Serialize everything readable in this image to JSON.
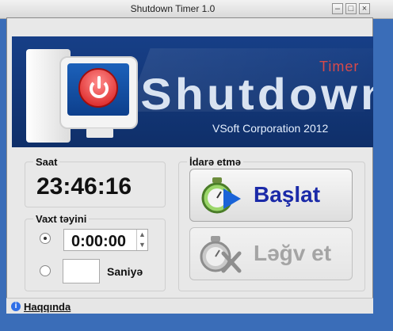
{
  "window": {
    "title": "Shutdown Timer 1.0"
  },
  "banner": {
    "title": "Shutdown",
    "subtitle": "Timer",
    "corporation": "VSoft Corporation 2012"
  },
  "clock": {
    "label": "Saat",
    "value": "23:46:16"
  },
  "timer": {
    "label": "Vaxt təyini",
    "time_value": "0:00:00",
    "seconds_label": "Saniyə",
    "selected_mode": "time"
  },
  "controls": {
    "label": "İdarə etmə",
    "start": "Başlat",
    "cancel": "Ləğv et"
  },
  "footer": {
    "about": "Haqqında"
  },
  "colors": {
    "accent": "#1b2aa8",
    "banner": "#173f87",
    "power": "#d61515"
  },
  "icons": {
    "info": "info-icon",
    "power": "power-icon",
    "stopwatch": "stopwatch-icon",
    "play": "play-icon",
    "cancel": "cancel-icon"
  }
}
